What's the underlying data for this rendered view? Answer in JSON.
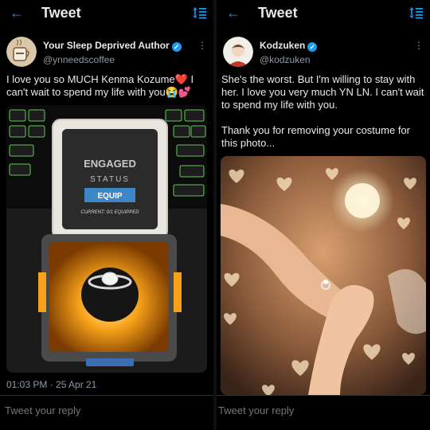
{
  "colors": {
    "accent": "#1d9bf0",
    "background": "#000000",
    "text": "#e7e9ea",
    "muted": "#8b98a5"
  },
  "left": {
    "header_title": "Tweet",
    "author_name": "Your Sleep Deprived Author",
    "handle": "@ynneedscoffee",
    "tweet_text": "I love you so MUCH Kenma Kozume❤️ I can't wait to spend my life with you😭💕",
    "media": {
      "box_line1": "ENGAGED",
      "box_line2": "STATUS",
      "box_button": "EQUIP",
      "box_footer": "CURRENT: 0/1 EQUIPPED"
    },
    "timestamp": "01:03 PM · 25 Apr 21",
    "reply_placeholder": "Tweet your reply"
  },
  "right": {
    "header_title": "Tweet",
    "author_name": "Kodzuken",
    "handle": "@kodzuken",
    "tweet_text_1": "She's the worst. But I'm willing to stay with her. I love you very much YN LN. I can't wait to spend my life with you.",
    "tweet_text_2": "Thank you for removing your costume for this photo...",
    "reply_placeholder": "Tweet your reply"
  },
  "icons": {
    "back": "arrow-left-icon",
    "sort": "sort-icon",
    "more": "more-vertical-icon",
    "verified": "verified-badge-icon"
  }
}
